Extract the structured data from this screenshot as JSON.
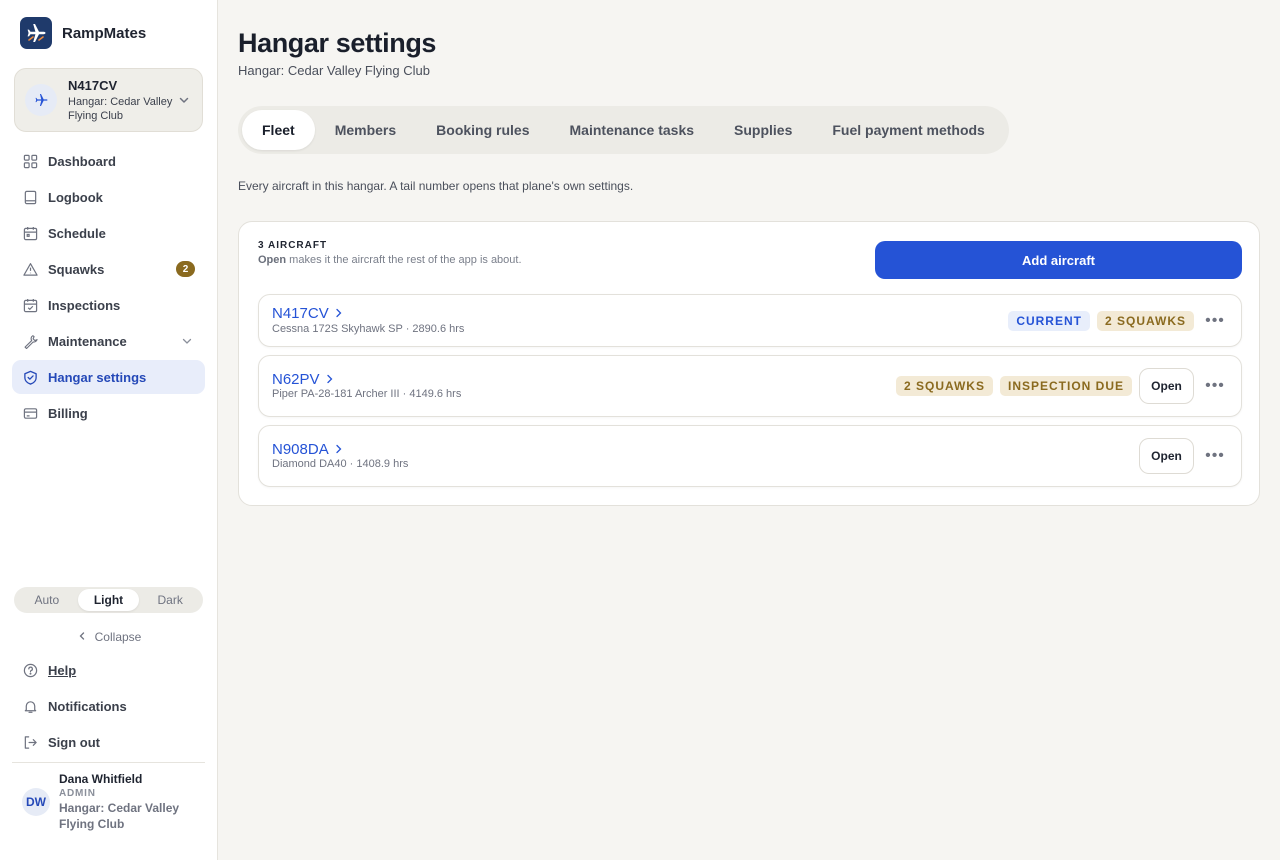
{
  "app": {
    "name": "RampMates"
  },
  "aircraft_switcher": {
    "tail": "N417CV",
    "hangar": "Hangar: Cedar Valley Flying Club"
  },
  "sidebar": {
    "items": [
      {
        "label": "Dashboard",
        "icon": "grid-icon"
      },
      {
        "label": "Logbook",
        "icon": "book-icon"
      },
      {
        "label": "Schedule",
        "icon": "calendar-icon"
      },
      {
        "label": "Squawks",
        "icon": "warning-icon",
        "badge": "2"
      },
      {
        "label": "Inspections",
        "icon": "calendar-check-icon"
      },
      {
        "label": "Maintenance",
        "icon": "wrench-icon"
      },
      {
        "label": "Hangar settings",
        "icon": "shield-icon"
      },
      {
        "label": "Billing",
        "icon": "card-icon"
      }
    ],
    "theme": {
      "options": [
        "Auto",
        "Light",
        "Dark"
      ],
      "selected": "Light"
    },
    "collapse_label": "Collapse",
    "bottom_items": [
      {
        "label": "Help",
        "icon": "help-icon"
      },
      {
        "label": "Notifications",
        "icon": "bell-icon"
      },
      {
        "label": "Sign out",
        "icon": "sign-out-icon"
      }
    ],
    "user": {
      "initials": "DW",
      "name": "Dana Whitfield",
      "role": "ADMIN",
      "hangar": "Hangar: Cedar Valley Flying Club"
    }
  },
  "page": {
    "title": "Hangar settings",
    "subtitle": "Hangar: Cedar Valley Flying Club",
    "tabs": [
      "Fleet",
      "Members",
      "Booking rules",
      "Maintenance tasks",
      "Supplies",
      "Fuel payment methods"
    ],
    "active_tab": "Fleet",
    "description": "Every aircraft in this hangar. A tail number opens that plane's own settings."
  },
  "fleet": {
    "count_label": "3 AIRCRAFT",
    "note_bold": "Open",
    "note_rest": " makes it the aircraft the rest of the app is about.",
    "add_label": "Add aircraft",
    "open_label": "Open",
    "aircraft": [
      {
        "tail": "N417CV",
        "meta": "Cessna 172S Skyhawk SP · 2890.6 hrs",
        "chips": [
          {
            "text": "CURRENT",
            "tone": "blue"
          },
          {
            "text": "2 SQUAWKS",
            "tone": "gold"
          }
        ]
      },
      {
        "tail": "N62PV",
        "meta": "Piper PA-28-181 Archer III · 4149.6 hrs",
        "chips": [
          {
            "text": "2 SQUAWKS",
            "tone": "gold"
          },
          {
            "text": "INSPECTION DUE",
            "tone": "gold"
          }
        ]
      },
      {
        "tail": "N908DA",
        "meta": "Diamond DA40 · 1408.9 hrs",
        "chips": []
      }
    ]
  },
  "colors": {
    "accent": "#2553d6",
    "brand": "#1f3a6b",
    "warning": "#8a6a1f"
  }
}
